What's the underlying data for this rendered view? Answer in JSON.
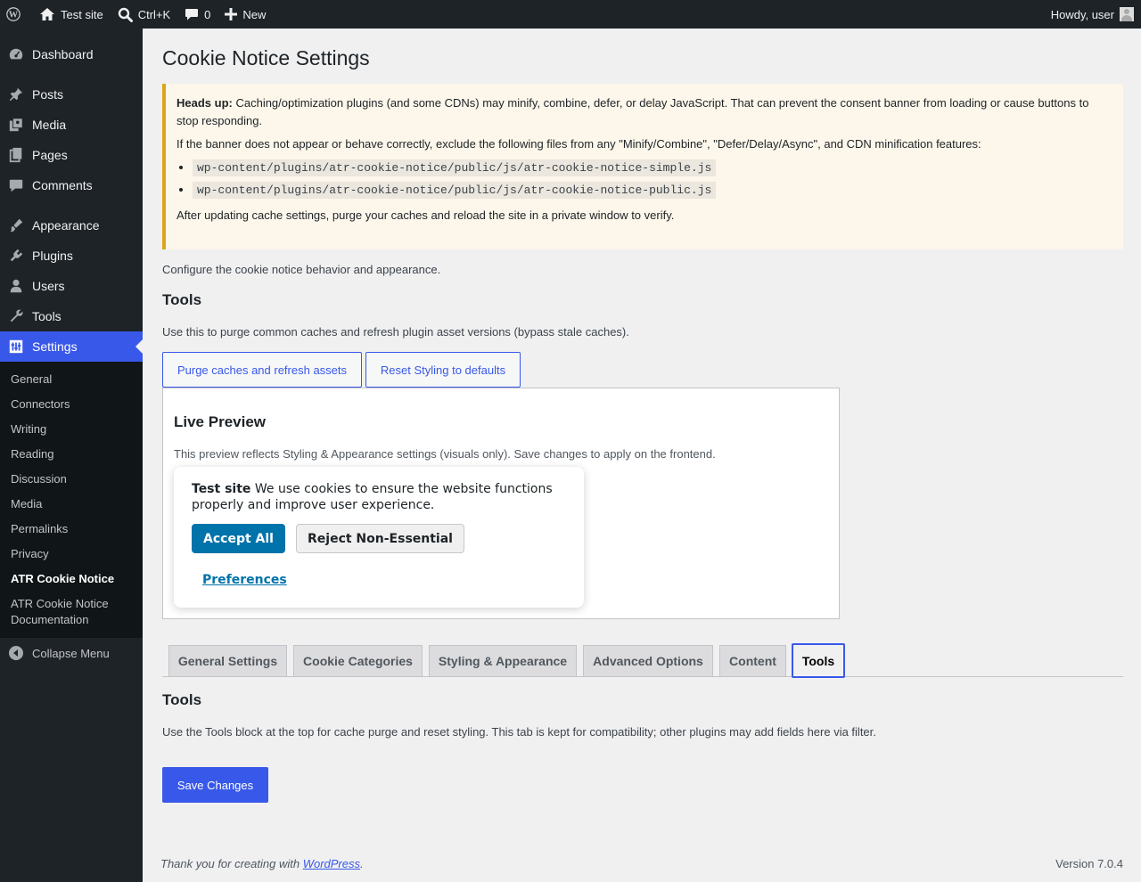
{
  "adminbar": {
    "site_name": "Test site",
    "search_shortcut": "Ctrl+K",
    "comments_count": "0",
    "new_label": "New",
    "howdy": "Howdy, user"
  },
  "sidebar": {
    "items": [
      {
        "label": "Dashboard",
        "icon": "dashboard-icon"
      },
      {
        "label": "Posts",
        "icon": "pin-icon"
      },
      {
        "label": "Media",
        "icon": "media-icon"
      },
      {
        "label": "Pages",
        "icon": "pages-icon"
      },
      {
        "label": "Comments",
        "icon": "comment-icon"
      },
      {
        "label": "Appearance",
        "icon": "brush-icon"
      },
      {
        "label": "Plugins",
        "icon": "plug-icon"
      },
      {
        "label": "Users",
        "icon": "user-icon"
      },
      {
        "label": "Tools",
        "icon": "wrench-icon"
      },
      {
        "label": "Settings",
        "icon": "settings-icon"
      }
    ],
    "submenu": [
      "General",
      "Connectors",
      "Writing",
      "Reading",
      "Discussion",
      "Media",
      "Permalinks",
      "Privacy",
      "ATR Cookie Notice",
      "ATR Cookie Notice Documentation"
    ],
    "collapse_label": "Collapse Menu"
  },
  "page": {
    "title": "Cookie Notice Settings",
    "notice": {
      "heads_up": "Heads up:",
      "line1": "Caching/optimization plugins (and some CDNs) may minify, combine, defer, or delay JavaScript. That can prevent the consent banner from loading or cause buttons to stop responding.",
      "line2": "If the banner does not appear or behave correctly, exclude the following files from any \"Minify/Combine\", \"Defer/Delay/Async\", and CDN minification features:",
      "files": [
        "wp-content/plugins/atr-cookie-notice/public/js/atr-cookie-notice-simple.js",
        "wp-content/plugins/atr-cookie-notice/public/js/atr-cookie-notice-public.js"
      ],
      "line3": "After updating cache settings, purge your caches and reload the site in a private window to verify."
    },
    "configure_desc": "Configure the cookie notice behavior and appearance.",
    "tools_heading": "Tools",
    "tools_desc": "Use this to purge common caches and refresh plugin asset versions (bypass stale caches).",
    "purge_button": "Purge caches and refresh assets",
    "reset_button": "Reset Styling to defaults",
    "preview": {
      "heading": "Live Preview",
      "desc": "This preview reflects Styling & Appearance settings (visuals only). Save changes to apply on the frontend.",
      "site_name": "Test site",
      "message": "We use cookies to ensure the website functions properly and improve user experience.",
      "accept": "Accept All",
      "reject": "Reject Non-Essential",
      "preferences": "Preferences"
    },
    "tabs": [
      "General Settings",
      "Cookie Categories",
      "Styling & Appearance",
      "Advanced Options",
      "Content",
      "Tools"
    ],
    "active_tab": "Tools",
    "tab_section_heading": "Tools",
    "tab_section_desc": "Use the Tools block at the top for cache purge and reset styling. This tab is kept for compatibility; other plugins may add fields here via filter.",
    "save_button": "Save Changes"
  },
  "footer": {
    "thanks_prefix": "Thank you for creating with ",
    "thanks_link": "WordPress",
    "thanks_suffix": ".",
    "version": "Version 7.0.4"
  },
  "colors": {
    "accent": "#3858e9",
    "adminbar_bg": "#1d2327",
    "notice_border": "#dba617",
    "cookie_accept": "#0073aa"
  }
}
